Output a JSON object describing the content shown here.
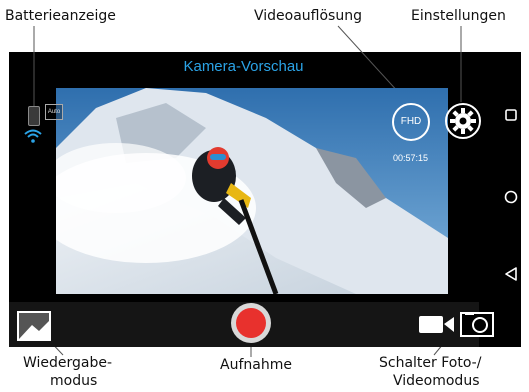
{
  "callouts": {
    "battery": "Batterieanzeige",
    "resolution": "Videoauflösung",
    "settings": "Einstellungen",
    "playback_line1": "Wiedergabe-",
    "playback_line2": "modus",
    "record": "Aufnahme",
    "switch_line1": "Schalter Foto-/",
    "switch_line2": "Videomodus"
  },
  "screen": {
    "title": "Kamera-Vorschau",
    "auto_badge": "Auto",
    "resolution_badge": "FHD",
    "recording_time": "00:57:15"
  },
  "icons": {
    "battery": "battery-icon",
    "wifi": "wifi-icon",
    "settings": "gear-icon",
    "gallery": "gallery-icon",
    "record": "record-button",
    "mode": "video-camera-icon",
    "nav_square": "recent-apps-icon",
    "nav_circle": "home-icon",
    "nav_triangle": "back-icon"
  },
  "colors": {
    "title": "#2ba3e6",
    "wifi": "#2ba3e6",
    "record": "#e8312d",
    "background": "#000000"
  }
}
